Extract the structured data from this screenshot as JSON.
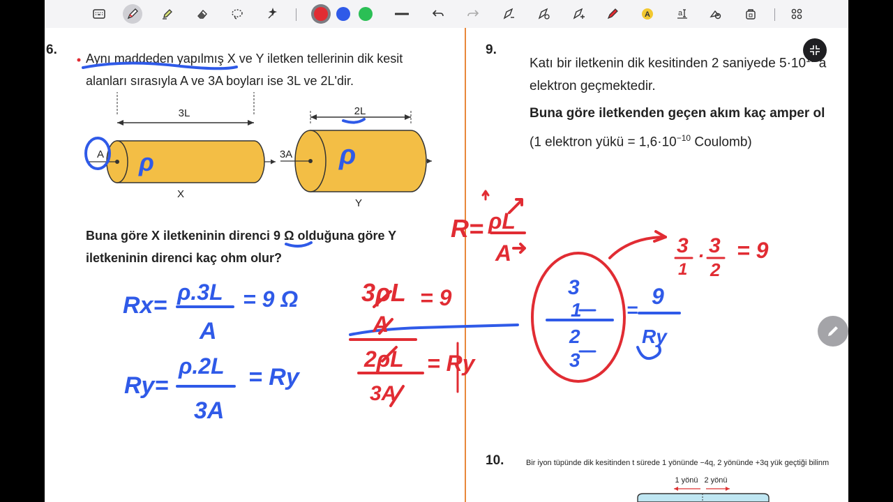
{
  "toolbar": {
    "tools": [
      "keyboard-icon",
      "pen-icon",
      "highlighter-icon",
      "eraser-icon",
      "lasso-icon",
      "magic-icon"
    ],
    "colors": [
      "#e12c33",
      "#2f5ae8",
      "#2bbf55"
    ],
    "extra_tools": [
      "stroke-width-icon",
      "undo-icon",
      "redo-icon",
      "shape-pen-icon",
      "shape-icon",
      "tape-icon",
      "laser-icon",
      "text-icon",
      "text-box-icon",
      "element-icon",
      "image-icon",
      "grid-icon"
    ]
  },
  "left": {
    "q_number": "6.",
    "intro_line1": "Aynı maddeden yapılmış X ve Y iletken tellerinin dik kesit",
    "intro_line2": "alanları sırasıyla A ve 3A boyları ise 3L ve 2L'dir.",
    "cyl_x_length": "3L",
    "cyl_x_area": "A",
    "cyl_x_name": "X",
    "cyl_y_length": "2L",
    "cyl_y_area": "3A",
    "cyl_y_name": "Y",
    "question_line1": "Buna göre X iletkeninin direnci 9 Ω olduğuna göre Y",
    "question_line2": "iletkeninin direnci kaç ohm olur?"
  },
  "right": {
    "q9_number": "9.",
    "q9_line1_pre": "Katı bir iletkenin dik kesitinden 2 saniyede 5·10",
    "q9_line1_sup": "19",
    "q9_line1_post": " a",
    "q9_line2": "elektron geçmektedir.",
    "q9_question": "Buna göre iletkenden geçen akım kaç amper ol",
    "q9_note_pre": "(1 elektron yükü = 1,6·10",
    "q9_note_sup": "−10",
    "q9_note_post": " Coulomb)",
    "q10_number": "10.",
    "q10_text": "Bir iyon tüpünde dik kesitinden t sürede 1 yönünde −4q, 2 yönünde +3q yük geçtiği bilinm",
    "q10_dir1": "1 yönü",
    "q10_dir2": "2 yönü"
  },
  "handwriting": {
    "blue": {
      "rho_x": "ρ",
      "rho_y": "ρ",
      "rx_lhs": "Rx=",
      "rx_num": "ρ.3L",
      "rx_den": "A",
      "rx_rhs": "= 9 Ω",
      "ry_lhs": "Ry=",
      "ry_num": "ρ.2L",
      "ry_den": "3A",
      "ry_rhs": "= Ry",
      "ratio_top_num": "3",
      "ratio_top_den": "1",
      "ratio_bot_num": "2",
      "ratio_bot_den": "3",
      "ratio_eq": "=",
      "ratio_rhs_num": "9",
      "ratio_rhs_den": "Ry"
    },
    "red": {
      "formula_r": "R=",
      "formula_num": "ρL",
      "formula_den": "A",
      "top_num": "3ρL",
      "top_den": "A",
      "top_eq": "= 9",
      "bot_num": "2ρL",
      "bot_den": "3A",
      "bot_eq": "= Ry",
      "product_a_num": "3",
      "product_a_den": "1",
      "product_dot": "·",
      "product_b_num": "3",
      "product_b_den": "2",
      "product_eq": "= 9"
    }
  }
}
